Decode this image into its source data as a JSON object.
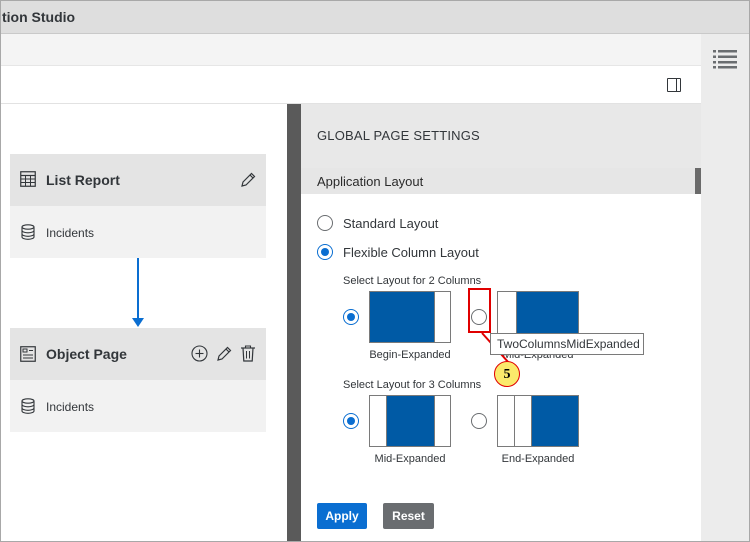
{
  "app": {
    "title": "tion Studio"
  },
  "canvas": {
    "cards": [
      {
        "title": "List Report",
        "entity": "Incidents",
        "icon": "table-icon",
        "actions": [
          "edit-icon"
        ]
      },
      {
        "title": "Object Page",
        "entity": "Incidents",
        "icon": "object-page-icon",
        "actions": [
          "add-icon",
          "edit-icon",
          "delete-icon"
        ]
      }
    ]
  },
  "settings": {
    "title": "GLOBAL PAGE SETTINGS",
    "section": "Application Layout",
    "layout_options": [
      {
        "label": "Standard Layout",
        "selected": false
      },
      {
        "label": "Flexible Column Layout",
        "selected": true
      }
    ],
    "two_columns": {
      "label": "Select Layout for 2 Columns",
      "options": [
        {
          "caption": "Begin-Expanded",
          "selected": true
        },
        {
          "caption": "Mid-Expanded",
          "selected": false
        }
      ]
    },
    "three_columns": {
      "label": "Select Layout for 3 Columns",
      "options": [
        {
          "caption": "Mid-Expanded",
          "selected": true
        },
        {
          "caption": "End-Expanded",
          "selected": false
        }
      ]
    },
    "apply_label": "Apply",
    "reset_label": "Reset"
  },
  "tooltip": "TwoColumnsMidExpanded",
  "callout": "5",
  "colors": {
    "accent": "#0a6ed1",
    "thumb_blue": "#005aa5",
    "callout_red": "#e00000",
    "callout_fill": "#fbe96b"
  }
}
